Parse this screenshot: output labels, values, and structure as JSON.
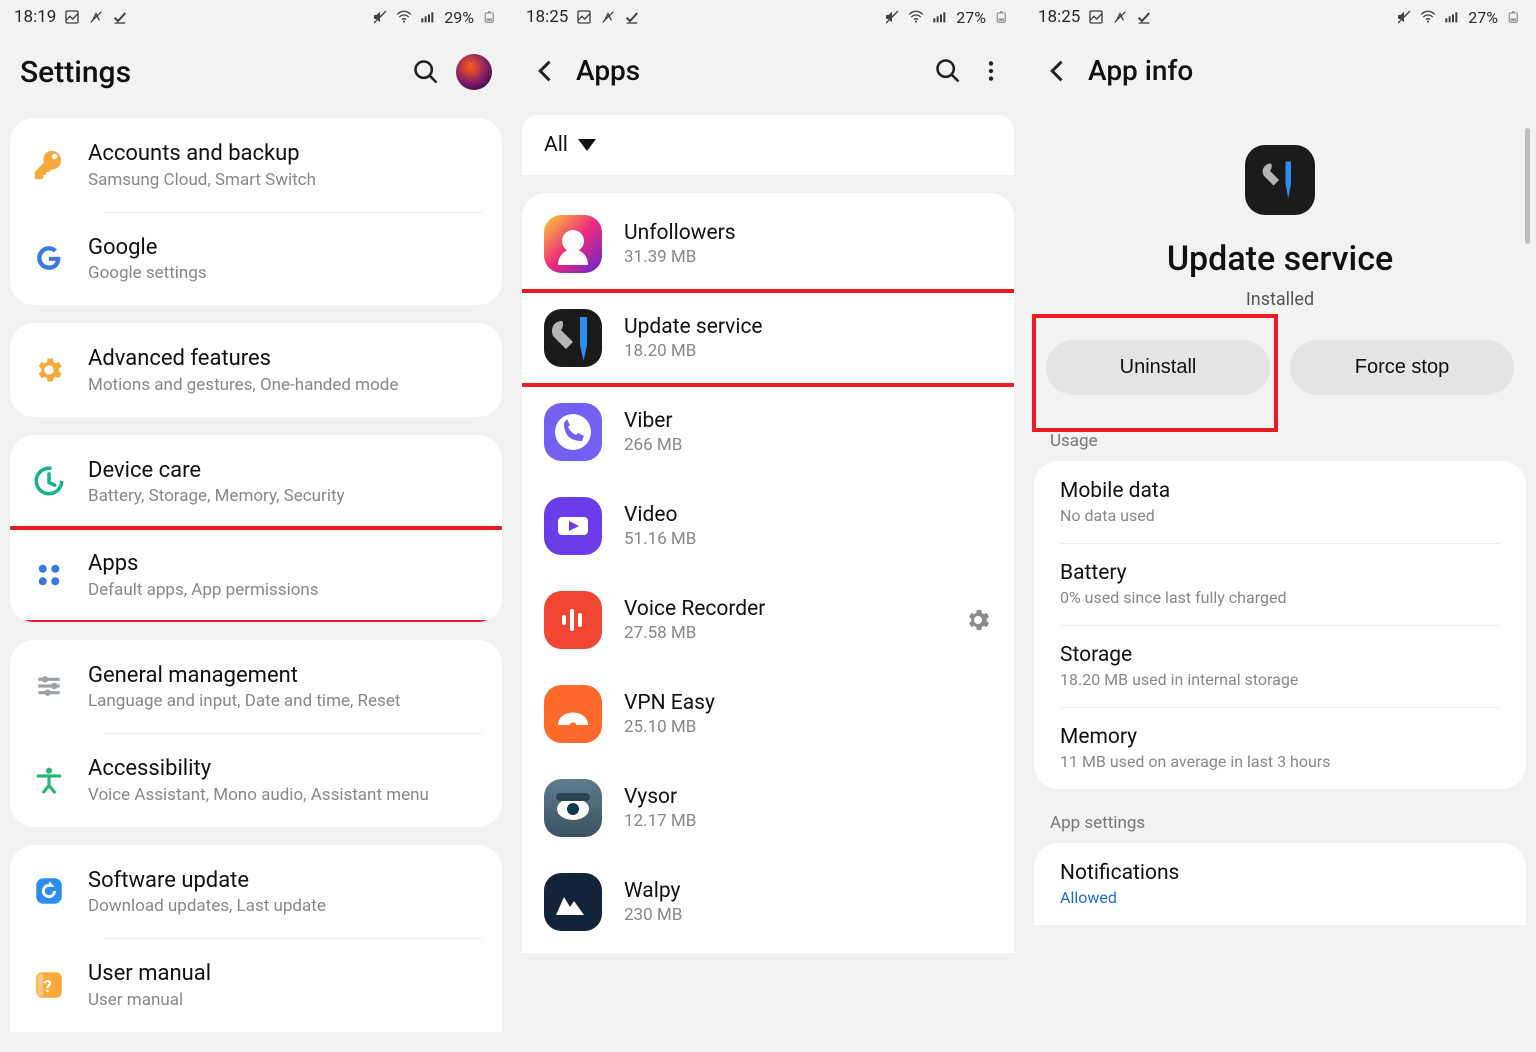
{
  "phone1": {
    "status": {
      "time": "18:19",
      "battery": "29%"
    },
    "header": {
      "title": "Settings"
    },
    "groups": [
      [
        {
          "icon": "key",
          "title": "Accounts and backup",
          "sub": "Samsung Cloud, Smart Switch"
        },
        {
          "icon": "google",
          "title": "Google",
          "sub": "Google settings"
        }
      ],
      [
        {
          "icon": "adv",
          "title": "Advanced features",
          "sub": "Motions and gestures, One-handed mode"
        }
      ],
      [
        {
          "icon": "care",
          "title": "Device care",
          "sub": "Battery, Storage, Memory, Security"
        },
        {
          "icon": "apps",
          "title": "Apps",
          "sub": "Default apps, App permissions",
          "hl": true
        }
      ],
      [
        {
          "icon": "gen",
          "title": "General management",
          "sub": "Language and input, Date and time, Reset"
        },
        {
          "icon": "acc",
          "title": "Accessibility",
          "sub": "Voice Assistant, Mono audio, Assistant menu"
        }
      ],
      [
        {
          "icon": "upd",
          "title": "Software update",
          "sub": "Download updates, Last update"
        },
        {
          "icon": "man",
          "title": "User manual",
          "sub": "User manual"
        }
      ]
    ]
  },
  "phone2": {
    "status": {
      "time": "18:25",
      "battery": "27%"
    },
    "header": {
      "title": "Apps"
    },
    "filter": "All",
    "apps": [
      {
        "name": "Unfollowers",
        "size": "31.39 MB",
        "bg": "unf"
      },
      {
        "name": "Update service",
        "size": "18.20 MB",
        "bg": "upds",
        "hl": true
      },
      {
        "name": "Viber",
        "size": "266 MB",
        "bg": "vib"
      },
      {
        "name": "Video",
        "size": "51.16 MB",
        "bg": "vid"
      },
      {
        "name": "Voice Recorder",
        "size": "27.58 MB",
        "bg": "vrec",
        "gear": true
      },
      {
        "name": "VPN Easy",
        "size": "25.10 MB",
        "bg": "vpn"
      },
      {
        "name": "Vysor",
        "size": "12.17 MB",
        "bg": "vys"
      },
      {
        "name": "Walpy",
        "size": "230 MB",
        "bg": "wal"
      }
    ]
  },
  "phone3": {
    "status": {
      "time": "18:25",
      "battery": "27%"
    },
    "header": {
      "title": "App info"
    },
    "app": {
      "name": "Update service",
      "status": "Installed"
    },
    "buttons": {
      "uninstall": "Uninstall",
      "forcestop": "Force stop"
    },
    "usage_label": "Usage",
    "usage": [
      {
        "t": "Mobile data",
        "s": "No data used"
      },
      {
        "t": "Battery",
        "s": "0% used since last fully charged"
      },
      {
        "t": "Storage",
        "s": "18.20 MB used in internal storage"
      },
      {
        "t": "Memory",
        "s": "11 MB used on average in last 3 hours"
      }
    ],
    "appsettings_label": "App settings",
    "notifications": {
      "t": "Notifications",
      "s": "Allowed"
    }
  }
}
